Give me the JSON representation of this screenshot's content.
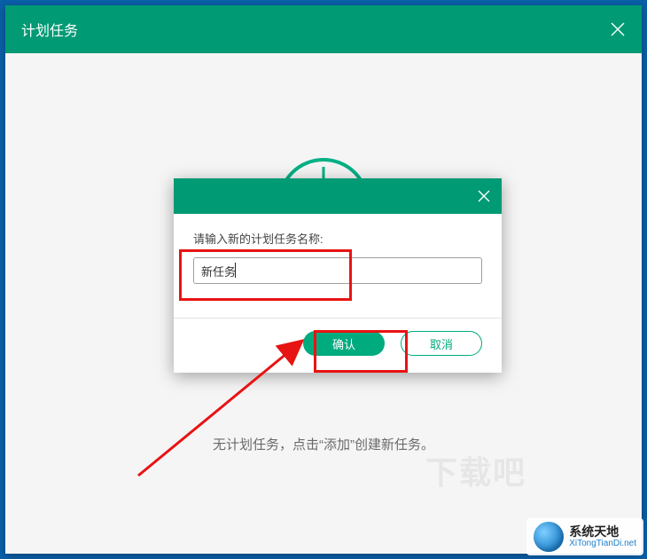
{
  "window": {
    "title": "计划任务"
  },
  "dialog": {
    "label": "请输入新的计划任务名称:",
    "input_value": "新任务",
    "confirm_label": "确认",
    "cancel_label": "取消"
  },
  "empty_state": {
    "text": "无计划任务，点击“添加”创建新任务。"
  },
  "watermark": {
    "text": "下载吧"
  },
  "brand": {
    "name": "系统天地",
    "url": "XiTongTianDi.net"
  }
}
